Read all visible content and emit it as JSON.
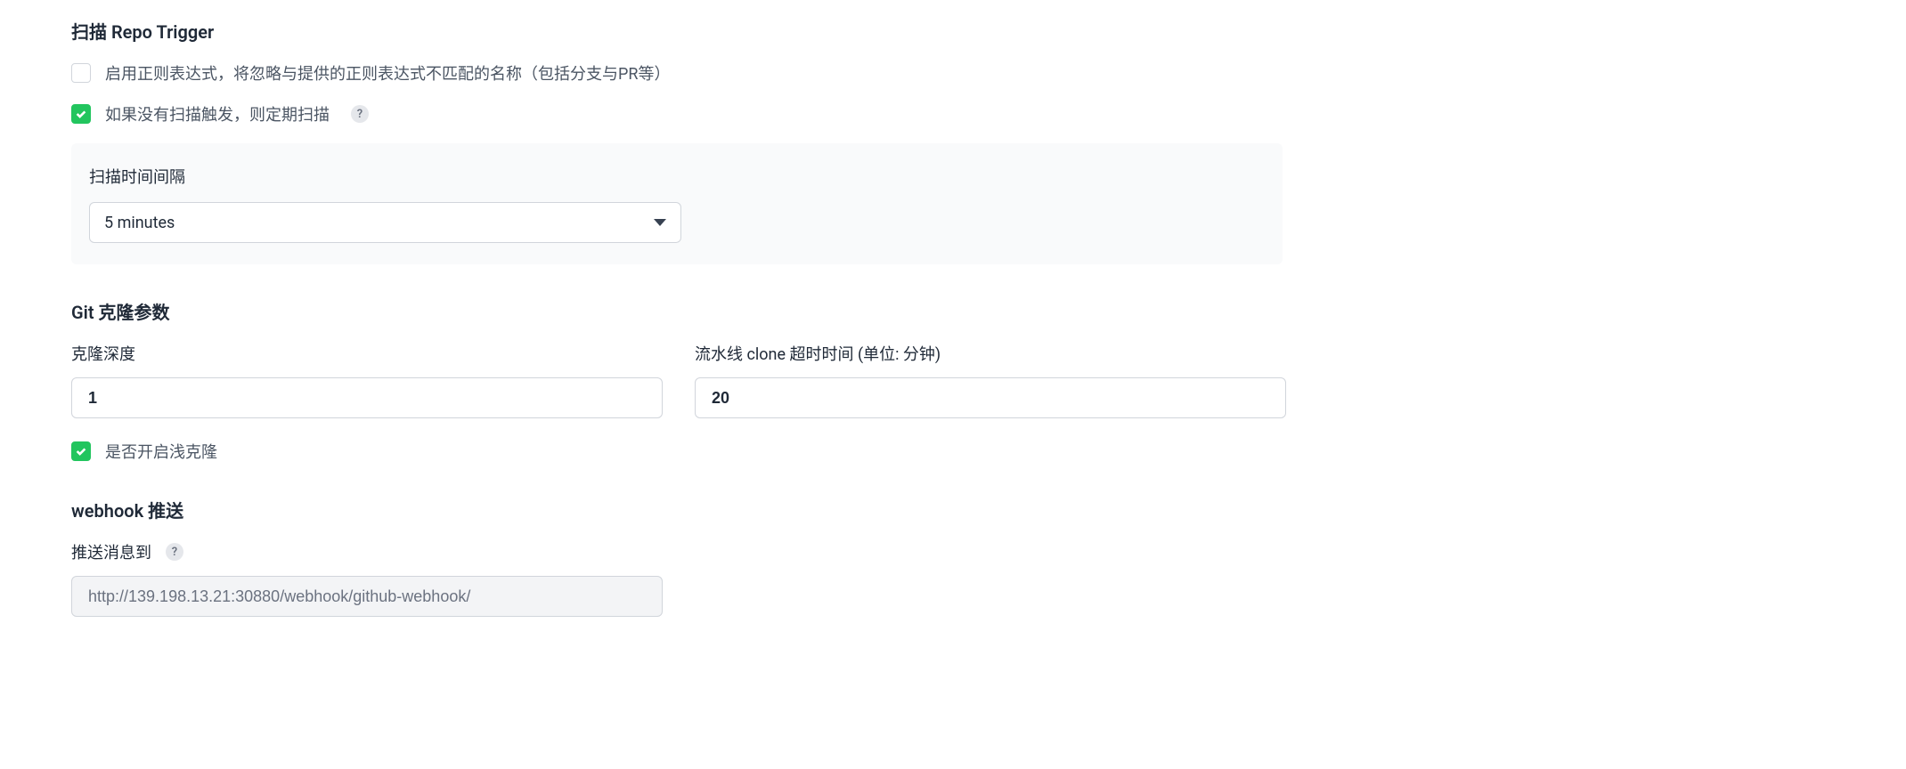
{
  "scan_repo_trigger": {
    "title": "扫描 Repo Trigger",
    "regex_checkbox": {
      "checked": false,
      "label": "启用正则表达式，将忽略与提供的正则表达式不匹配的名称（包括分支与PR等）"
    },
    "periodic_scan_checkbox": {
      "checked": true,
      "label": "如果没有扫描触发，则定期扫描"
    },
    "scan_interval": {
      "label": "扫描时间间隔",
      "value": "5 minutes"
    }
  },
  "git_clone_params": {
    "title": "Git 克隆参数",
    "clone_depth": {
      "label": "克隆深度",
      "value": "1"
    },
    "clone_timeout": {
      "label": "流水线 clone 超时时间 (单位: 分钟)",
      "value": "20"
    },
    "shallow_clone_checkbox": {
      "checked": true,
      "label": "是否开启浅克隆"
    }
  },
  "webhook_push": {
    "title": "webhook 推送",
    "push_to": {
      "label": "推送消息到",
      "value": "http://139.198.13.21:30880/webhook/github-webhook/"
    }
  }
}
